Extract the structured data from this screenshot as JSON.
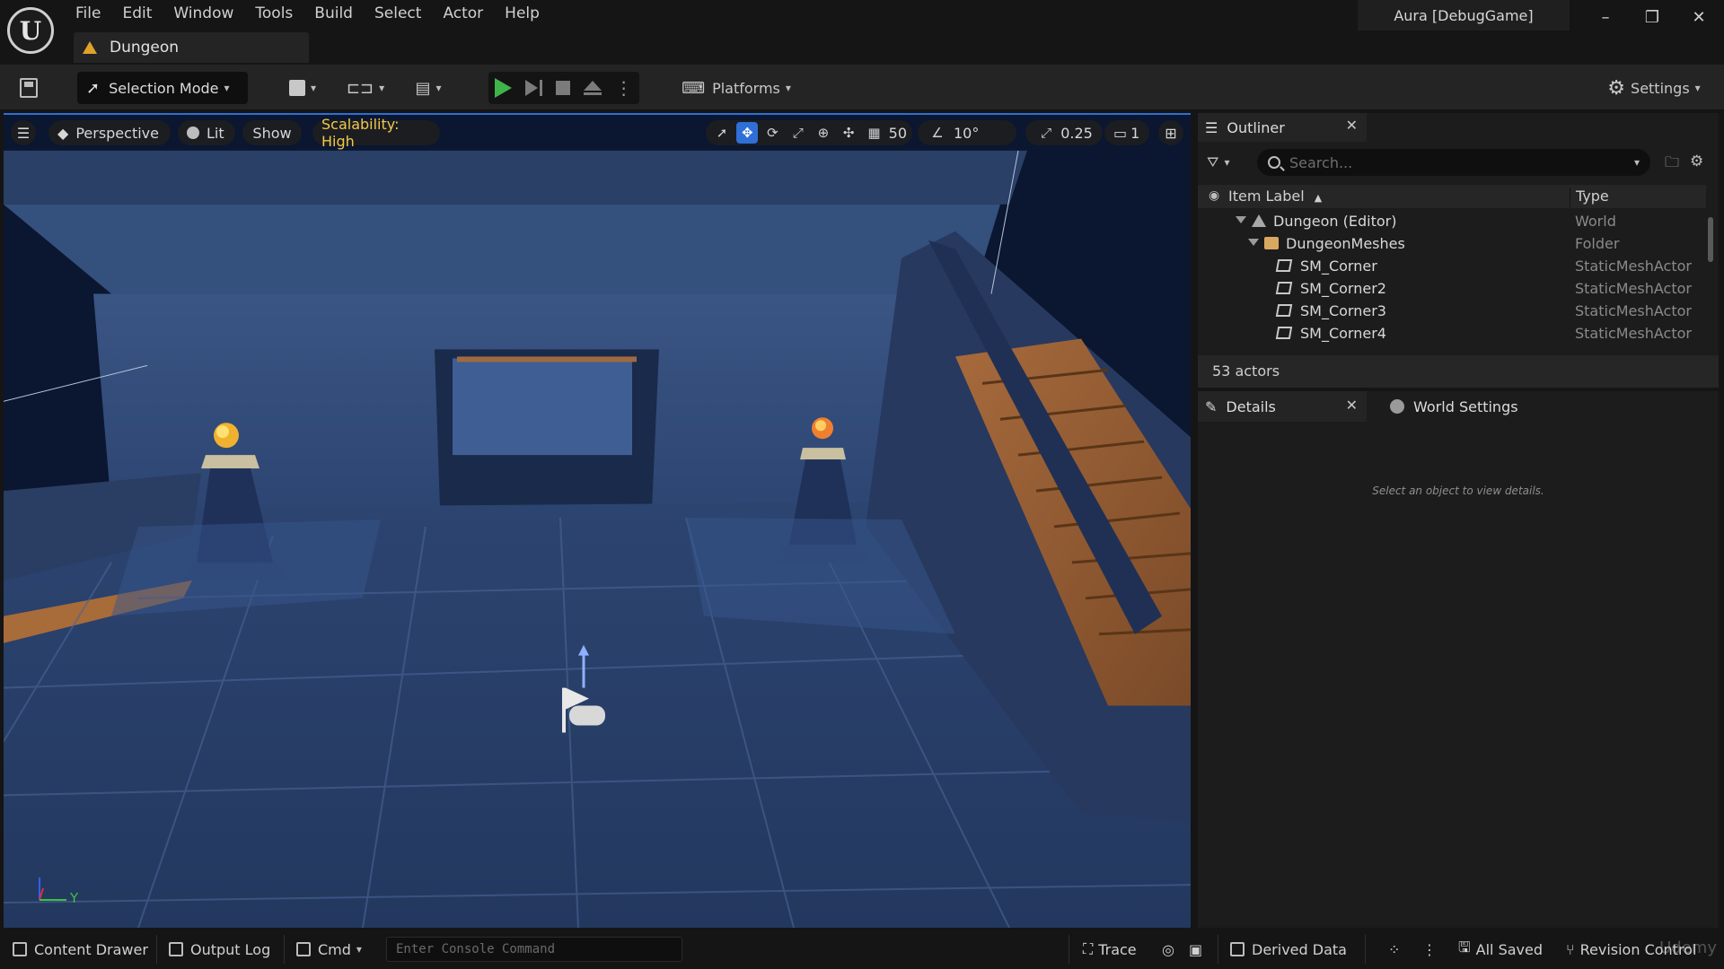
{
  "app": {
    "logo_text": "U",
    "project": "Aura [DebugGame]"
  },
  "menu": [
    "File",
    "Edit",
    "Window",
    "Tools",
    "Build",
    "Select",
    "Actor",
    "Help"
  ],
  "level_tab": {
    "label": "Dungeon"
  },
  "window_controls": {
    "minimize": "–",
    "restore": "❐",
    "close": "✕"
  },
  "toolbar": {
    "selection_mode": "Selection Mode",
    "platforms": "Platforms",
    "settings": "Settings"
  },
  "viewport": {
    "perspective": "Perspective",
    "lit": "Lit",
    "show": "Show",
    "scalability": "Scalability: High",
    "grid_snap": "50",
    "rotation_snap": "10°",
    "scale_snap": "0.25",
    "camera_speed": "1",
    "axis_label": "Y"
  },
  "outliner": {
    "tab": "Outliner",
    "search_placeholder": "Search...",
    "col_label": "Item Label",
    "col_type": "Type",
    "rows": [
      {
        "label": "Dungeon (Editor)",
        "type": "World"
      },
      {
        "label": "DungeonMeshes",
        "type": "Folder"
      },
      {
        "label": "SM_Corner",
        "type": "StaticMeshActor"
      },
      {
        "label": "SM_Corner2",
        "type": "StaticMeshActor"
      },
      {
        "label": "SM_Corner3",
        "type": "StaticMeshActor"
      },
      {
        "label": "SM_Corner4",
        "type": "StaticMeshActor"
      }
    ],
    "actor_count": "53 actors"
  },
  "details": {
    "tab": "Details",
    "world_settings_tab": "World Settings",
    "empty_message": "Select an object to view details."
  },
  "statusbar": {
    "content_drawer": "Content Drawer",
    "output_log": "Output Log",
    "cmd": "Cmd",
    "console_placeholder": "Enter Console Command",
    "trace": "Trace",
    "derived_data": "Derived Data",
    "all_saved": "All Saved",
    "revision_control": "Revision Control",
    "watermark": "Udemy"
  },
  "colors": {
    "accent": "#2f6fd6",
    "play": "#3fb44a",
    "scalability": "#f2c84b",
    "folder": "#d8a860"
  },
  "icons": [
    "save-icon",
    "select-arrow-icon",
    "add-actor-icon",
    "blueprint-icon",
    "cinematics-icon",
    "play-icon",
    "step-icon",
    "stop-icon",
    "eject-icon",
    "platforms-icon",
    "gear-icon",
    "filter-icon",
    "search-icon",
    "new-folder-icon",
    "eye-icon",
    "world-icon",
    "folder-icon",
    "static-mesh-icon",
    "pencil-icon",
    "globe-icon"
  ]
}
